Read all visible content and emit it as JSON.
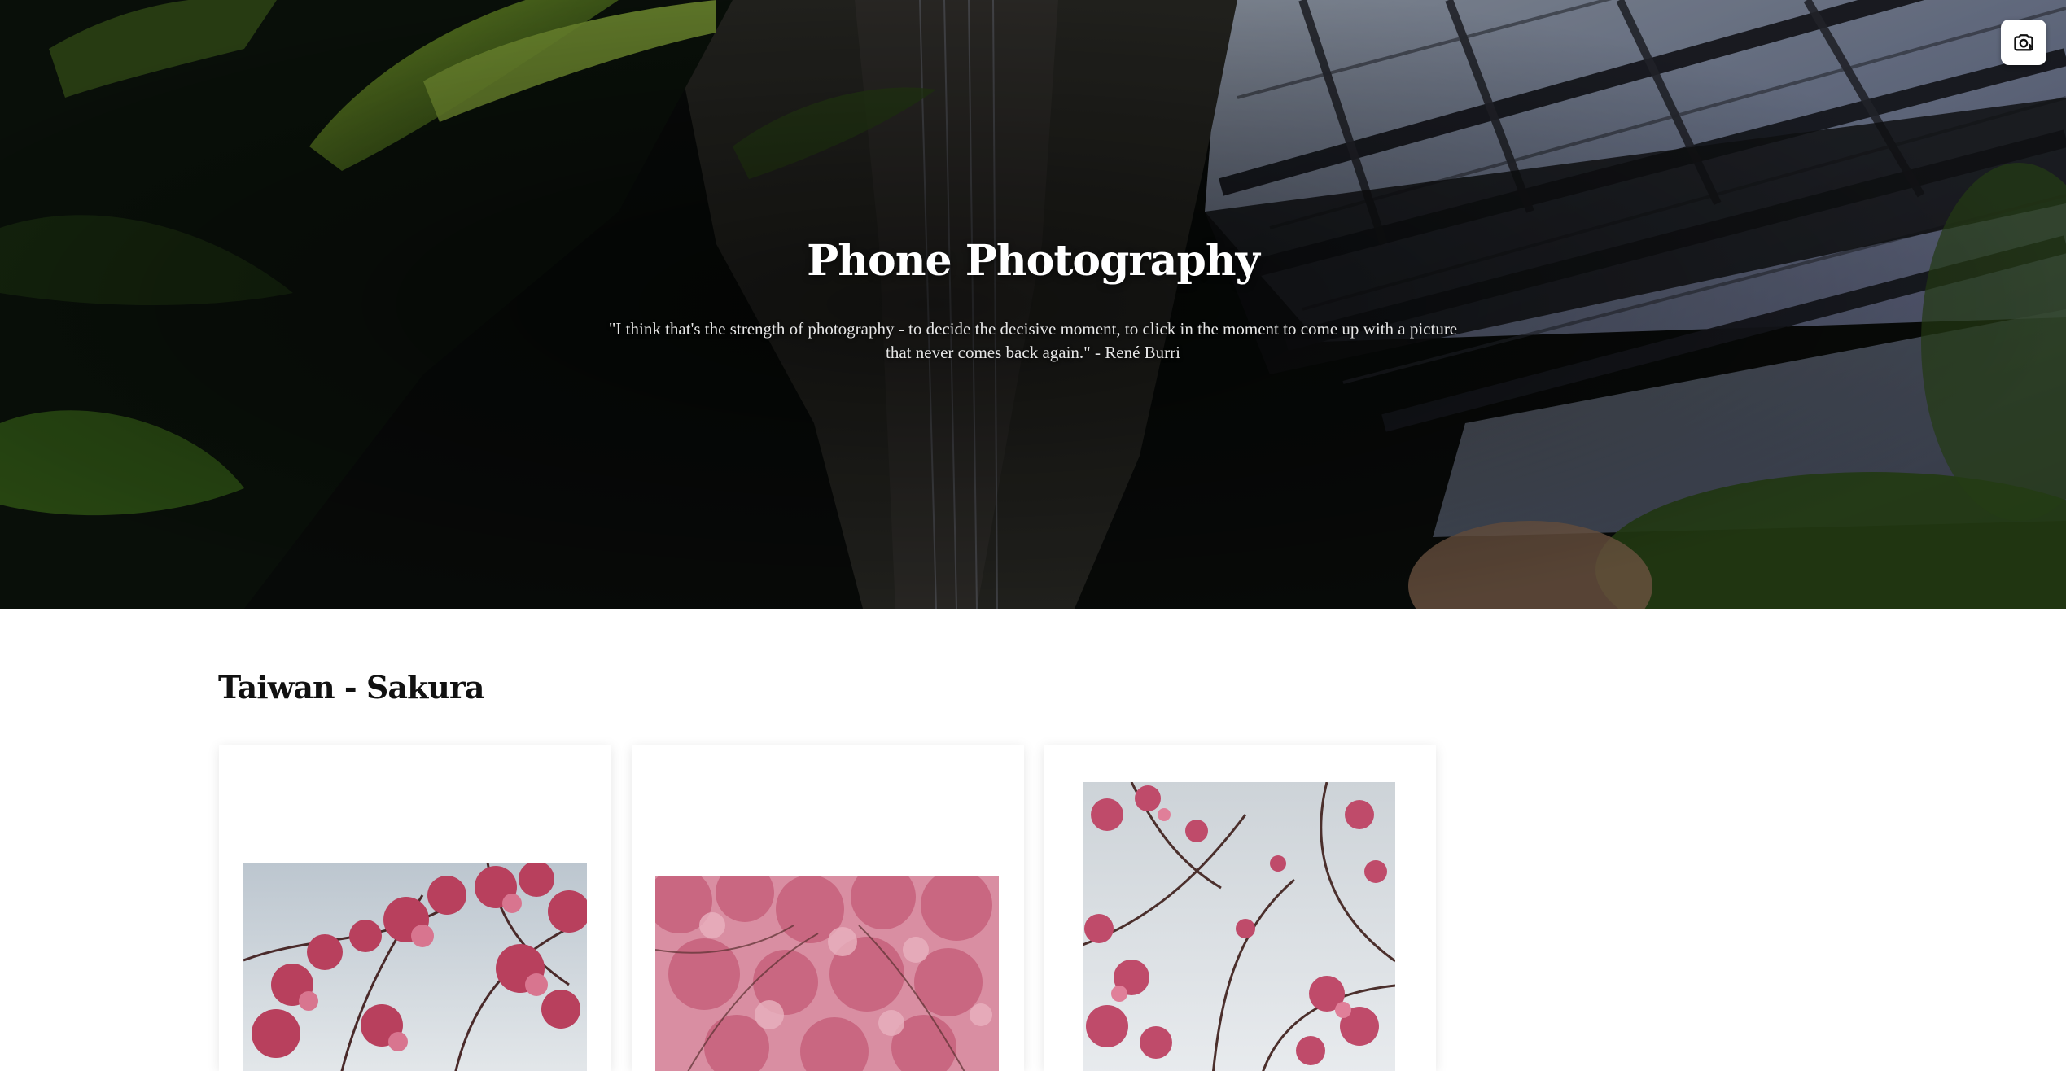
{
  "hero": {
    "title": "Phone Photography",
    "quote_line1": "\"I think that's the strength of photography - to decide the decisive moment, to click in the moment to come up with a picture",
    "quote_line2": "that never comes back again.\" - René Burri"
  },
  "toolbar": {
    "camera_icon": "camera-icon"
  },
  "gallery": {
    "section_title": "Taiwan - Sakura",
    "photos": [
      {
        "subject": "cherry blossoms against cloudy sky"
      },
      {
        "subject": "dense pink cherry blossom canopy"
      },
      {
        "subject": "cherry blossom branches, portrait"
      }
    ]
  },
  "colors": {
    "page_background": "#ffffff",
    "hero_text": "#ffffff",
    "sakura_pink": "#c9607e"
  }
}
